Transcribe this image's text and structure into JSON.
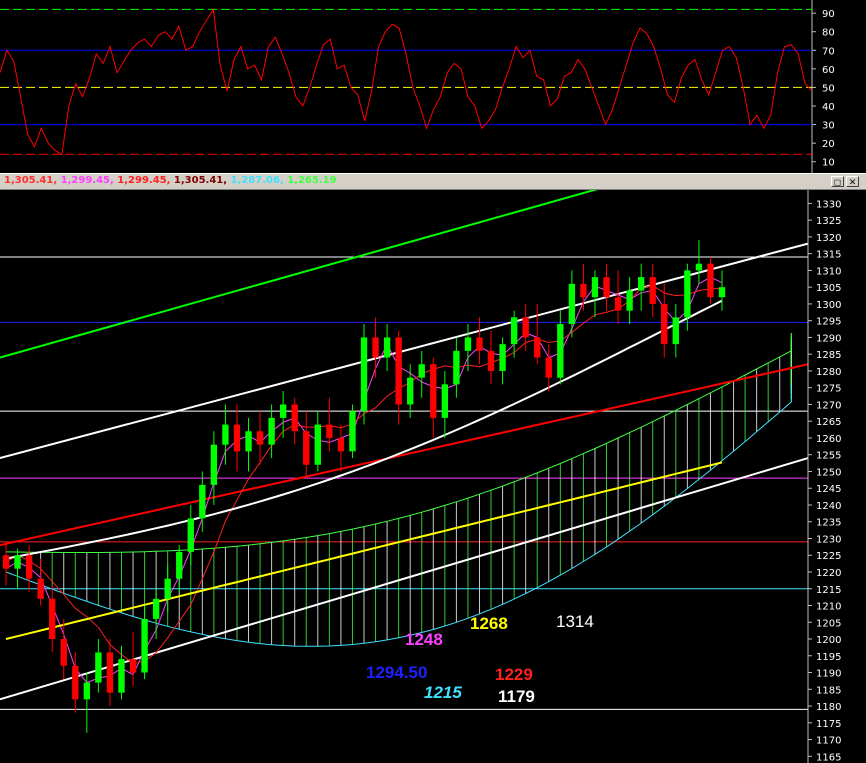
{
  "header": {
    "ohlc": [
      {
        "text": "1,305.41,",
        "color": "#ff3030"
      },
      {
        "text": "1,299.45,",
        "color": "#ff40ff"
      },
      {
        "text": "1,299.45,",
        "color": "#ff2020"
      },
      {
        "text": "1,305.41,",
        "color": "#800000"
      },
      {
        "text": "1,287.06,",
        "color": "#40e0ff"
      },
      {
        "text": "1,265.19",
        "color": "#40ff40"
      }
    ],
    "restore_glyph": "◻",
    "close_glyph": "✕"
  },
  "annotations": [
    {
      "text": "1268",
      "color": "#ffff00",
      "italic": false
    },
    {
      "text": "1314",
      "color": "#ffffff",
      "italic": false
    },
    {
      "text": "1248",
      "color": "#ff40ff",
      "italic": false
    },
    {
      "text": "1294.50",
      "color": "#2020ff",
      "italic": false
    },
    {
      "text": "1229",
      "color": "#ff2020",
      "italic": false
    },
    {
      "text": "1215",
      "color": "#40e0ff",
      "italic": true
    },
    {
      "text": "1179",
      "color": "#ffffff",
      "italic": false
    }
  ],
  "chart_data": [
    {
      "type": "line",
      "ylim": [
        5,
        96
      ],
      "yticks": [
        10,
        20,
        30,
        40,
        50,
        60,
        70,
        80,
        90
      ],
      "reference_lines": [
        {
          "y": 92,
          "color": "#00ff00",
          "style": "dashed"
        },
        {
          "y": 70,
          "color": "#0000ff",
          "style": "solid"
        },
        {
          "y": 50,
          "color": "#ffff00",
          "style": "dashed"
        },
        {
          "y": 30,
          "color": "#0000ff",
          "style": "solid"
        },
        {
          "y": 14,
          "color": "#ff0000",
          "style": "dashed"
        }
      ],
      "series": [
        {
          "color": "#ff0000",
          "values": [
            58,
            70,
            64,
            45,
            25,
            18,
            28,
            20,
            16,
            14,
            40,
            52,
            45,
            55,
            68,
            63,
            72,
            58,
            64,
            70,
            74,
            76,
            72,
            78,
            80,
            76,
            83,
            70,
            72,
            80,
            86,
            92,
            62,
            48,
            65,
            72,
            60,
            62,
            54,
            72,
            77,
            68,
            58,
            45,
            40,
            50,
            62,
            73,
            76,
            60,
            62,
            50,
            46,
            32,
            48,
            72,
            80,
            84,
            82,
            68,
            50,
            40,
            28,
            38,
            45,
            58,
            63,
            60,
            45,
            40,
            28,
            32,
            38,
            50,
            60,
            72,
            66,
            70,
            56,
            54,
            40,
            44,
            56,
            58,
            65,
            60,
            50,
            40,
            30,
            38,
            50,
            62,
            74,
            82,
            79,
            72,
            60,
            46,
            42,
            55,
            62,
            65,
            54,
            46,
            58,
            70,
            72,
            66,
            50,
            30,
            35,
            28,
            35,
            58,
            72,
            73,
            68,
            52,
            48
          ]
        }
      ]
    },
    {
      "type": "candlestick",
      "ylim": [
        1163,
        1334
      ],
      "yticks": [
        1165,
        1170,
        1175,
        1180,
        1185,
        1190,
        1195,
        1200,
        1205,
        1210,
        1215,
        1220,
        1225,
        1230,
        1235,
        1240,
        1245,
        1250,
        1255,
        1260,
        1265,
        1270,
        1275,
        1280,
        1285,
        1290,
        1295,
        1300,
        1305,
        1310,
        1315,
        1320,
        1325,
        1330
      ],
      "up_color": "#00ff00",
      "down_color": "#ff0000",
      "candles": [
        [
          1225,
          1229,
          1216,
          1221
        ],
        [
          1221,
          1227,
          1215,
          1225
        ],
        [
          1225,
          1228,
          1214,
          1218
        ],
        [
          1218,
          1224,
          1210,
          1212
        ],
        [
          1212,
          1216,
          1196,
          1200
        ],
        [
          1200,
          1206,
          1188,
          1192
        ],
        [
          1192,
          1196,
          1178,
          1182
        ],
        [
          1182,
          1190,
          1172,
          1187
        ],
        [
          1187,
          1200,
          1184,
          1196
        ],
        [
          1196,
          1200,
          1180,
          1184
        ],
        [
          1184,
          1198,
          1182,
          1194
        ],
        [
          1194,
          1202,
          1186,
          1190
        ],
        [
          1190,
          1210,
          1188,
          1206
        ],
        [
          1206,
          1215,
          1200,
          1212
        ],
        [
          1212,
          1222,
          1208,
          1218
        ],
        [
          1218,
          1228,
          1214,
          1226
        ],
        [
          1226,
          1240,
          1222,
          1236
        ],
        [
          1236,
          1250,
          1232,
          1246
        ],
        [
          1246,
          1262,
          1240,
          1258
        ],
        [
          1258,
          1270,
          1252,
          1264
        ],
        [
          1264,
          1270,
          1250,
          1256
        ],
        [
          1256,
          1266,
          1250,
          1262
        ],
        [
          1262,
          1268,
          1252,
          1258
        ],
        [
          1258,
          1270,
          1254,
          1266
        ],
        [
          1266,
          1274,
          1260,
          1270
        ],
        [
          1270,
          1272,
          1258,
          1262
        ],
        [
          1262,
          1268,
          1248,
          1252
        ],
        [
          1252,
          1268,
          1250,
          1264
        ],
        [
          1264,
          1272,
          1256,
          1260
        ],
        [
          1260,
          1264,
          1250,
          1256
        ],
        [
          1256,
          1270,
          1254,
          1268
        ],
        [
          1268,
          1294,
          1264,
          1290
        ],
        [
          1290,
          1296,
          1278,
          1284
        ],
        [
          1284,
          1294,
          1280,
          1290
        ],
        [
          1290,
          1292,
          1264,
          1270
        ],
        [
          1270,
          1282,
          1266,
          1278
        ],
        [
          1278,
          1286,
          1272,
          1282
        ],
        [
          1282,
          1284,
          1260,
          1266
        ],
        [
          1266,
          1280,
          1260,
          1276
        ],
        [
          1276,
          1290,
          1272,
          1286
        ],
        [
          1286,
          1294,
          1280,
          1290
        ],
        [
          1290,
          1296,
          1282,
          1286
        ],
        [
          1286,
          1292,
          1276,
          1280
        ],
        [
          1280,
          1290,
          1276,
          1288
        ],
        [
          1288,
          1298,
          1284,
          1296
        ],
        [
          1296,
          1300,
          1286,
          1290
        ],
        [
          1290,
          1300,
          1282,
          1284
        ],
        [
          1284,
          1288,
          1274,
          1278
        ],
        [
          1278,
          1298,
          1276,
          1294
        ],
        [
          1294,
          1310,
          1290,
          1306
        ],
        [
          1306,
          1312,
          1298,
          1302
        ],
        [
          1302,
          1310,
          1296,
          1308
        ],
        [
          1308,
          1312,
          1298,
          1302
        ],
        [
          1302,
          1310,
          1294,
          1298
        ],
        [
          1298,
          1308,
          1294,
          1304
        ],
        [
          1304,
          1312,
          1298,
          1308
        ],
        [
          1308,
          1312,
          1296,
          1300
        ],
        [
          1300,
          1306,
          1284,
          1288
        ],
        [
          1288,
          1300,
          1284,
          1296
        ],
        [
          1296,
          1312,
          1292,
          1310
        ],
        [
          1310,
          1319,
          1306,
          1312
        ],
        [
          1312,
          1314,
          1300,
          1302
        ],
        [
          1302,
          1310,
          1298,
          1305
        ]
      ]
    }
  ]
}
